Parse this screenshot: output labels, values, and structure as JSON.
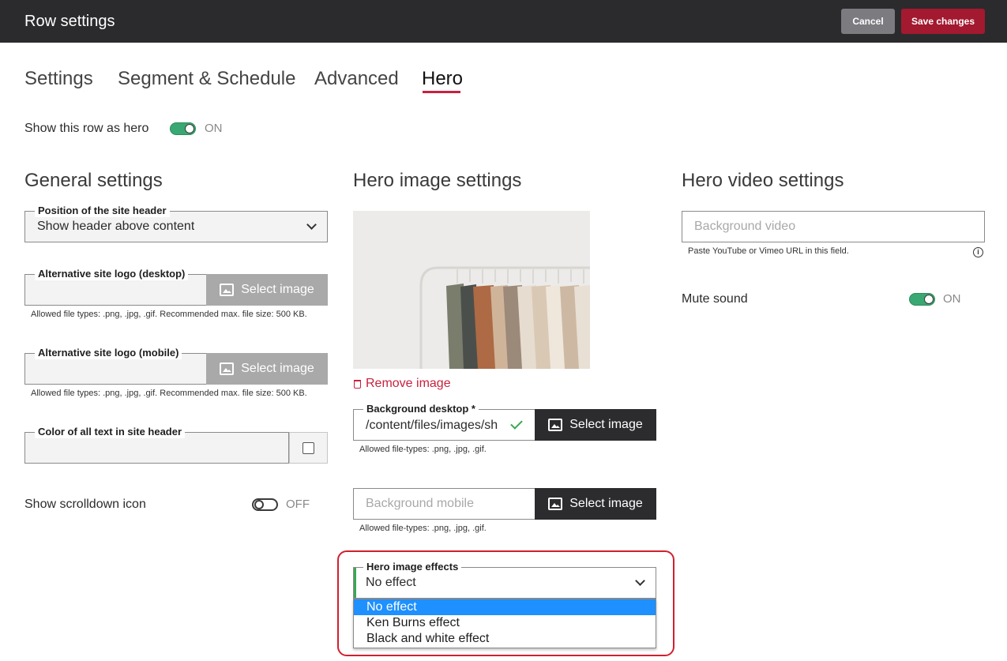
{
  "header": {
    "title": "Row settings",
    "cancel_label": "Cancel",
    "save_label": "Save changes"
  },
  "tabs": [
    {
      "label": "Settings",
      "active": false
    },
    {
      "label": "Segment & Schedule",
      "active": false
    },
    {
      "label": "Advanced",
      "active": false
    },
    {
      "label": "Hero",
      "active": true
    }
  ],
  "hero_toggle": {
    "label": "Show this row as hero",
    "state": "ON",
    "on": true
  },
  "general": {
    "title": "General settings",
    "header_position": {
      "legend": "Position of the site header",
      "value": "Show header above content"
    },
    "logo_desktop": {
      "legend": "Alternative site logo (desktop)",
      "button": "Select image",
      "hint": "Allowed file types: .png, .jpg, .gif. Recommended max. file size: 500 KB."
    },
    "logo_mobile": {
      "legend": "Alternative site logo (mobile)",
      "button": "Select image",
      "hint": "Allowed file types: .png, .jpg, .gif. Recommended max. file size: 500 KB."
    },
    "text_color": {
      "legend": "Color of all text in site header"
    },
    "scrolldown": {
      "label": "Show scrolldown icon",
      "state": "OFF",
      "on": false
    }
  },
  "hero_image": {
    "title": "Hero image settings",
    "remove_label": "Remove image",
    "bg_desktop": {
      "legend": "Background desktop *",
      "value": "/content/files/images/sh",
      "button": "Select image",
      "hint": "Allowed file-types: .png, .jpg, .gif."
    },
    "bg_mobile": {
      "placeholder": "Background mobile",
      "button": "Select image",
      "hint": "Allowed file-types: .png, .jpg, .gif."
    },
    "effects": {
      "legend": "Hero image effects",
      "value": "No effect",
      "options": [
        "No effect",
        "Ken Burns effect",
        "Black and white effect"
      ]
    }
  },
  "hero_video": {
    "title": "Hero video settings",
    "placeholder": "Background video",
    "hint": "Paste YouTube or Vimeo URL in this field.",
    "mute": {
      "label": "Mute sound",
      "state": "ON",
      "on": true
    }
  },
  "colors": {
    "accent": "#c8213f",
    "toggle_on": "#3aa872",
    "topbar": "#2b2b2e",
    "save": "#a3192f"
  }
}
